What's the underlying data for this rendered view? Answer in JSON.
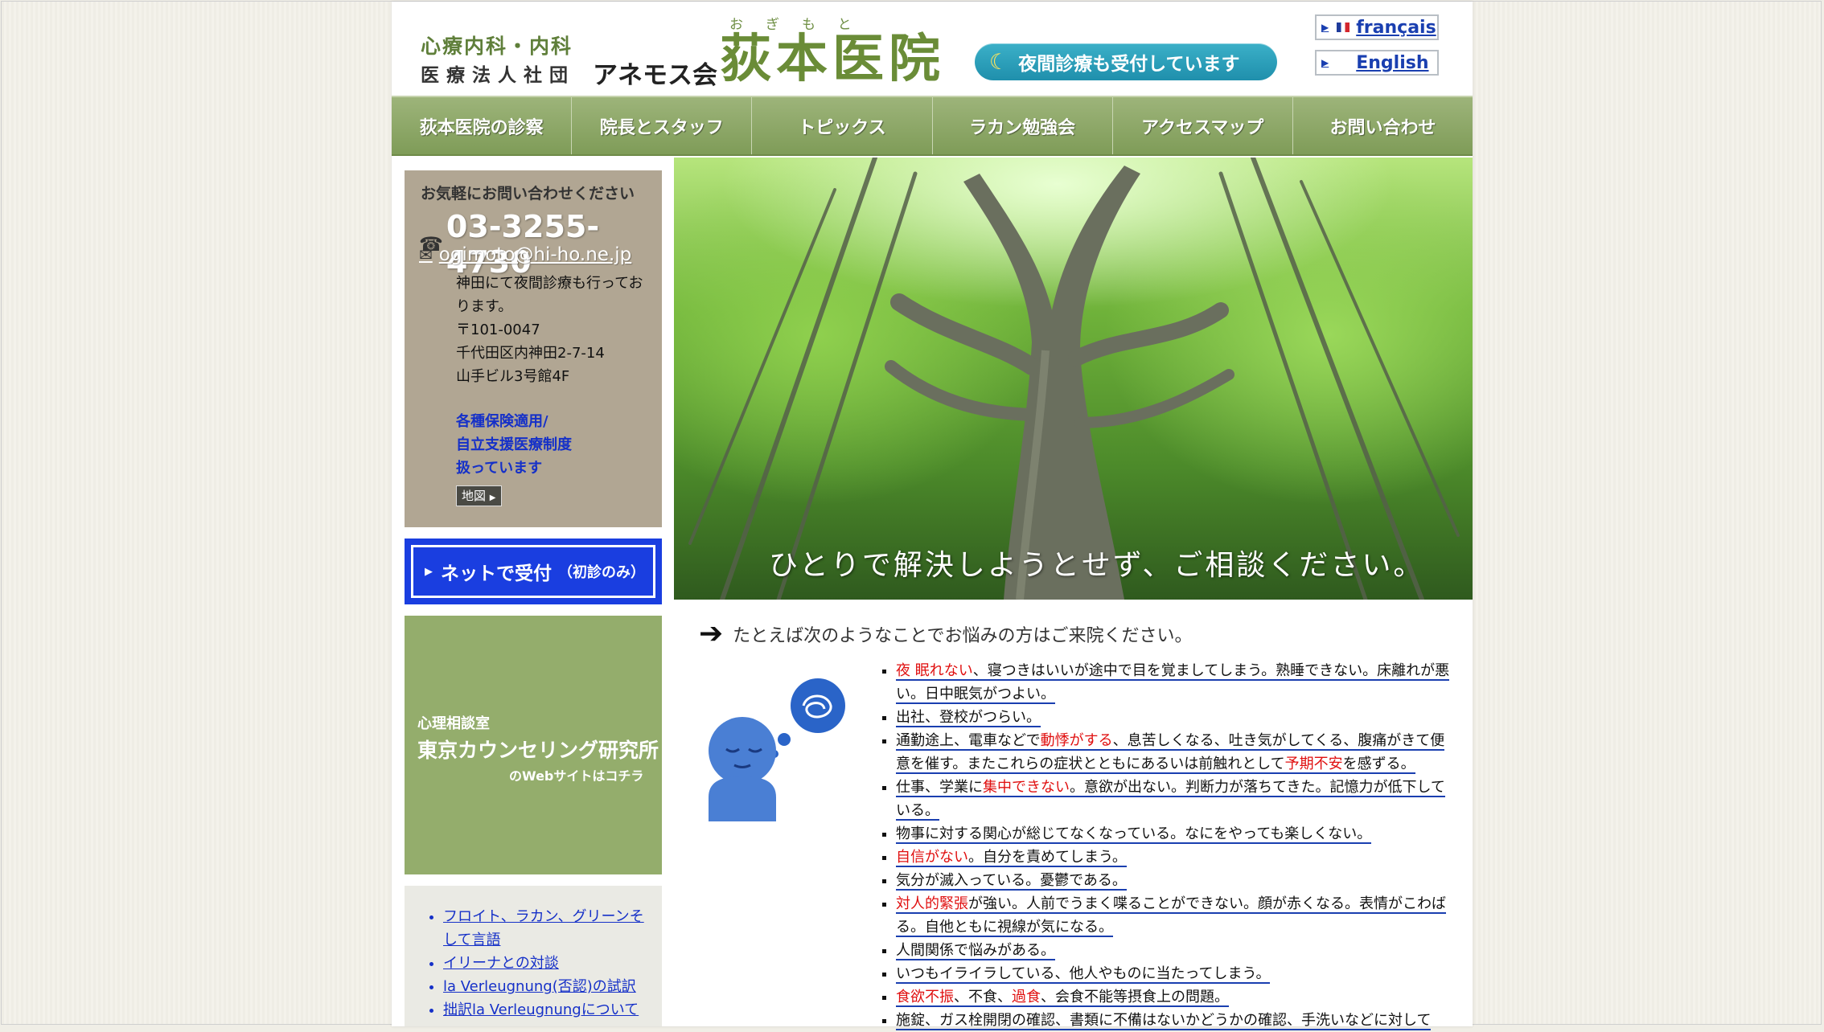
{
  "header": {
    "dept": "心療内科・内科",
    "corp": "医療法人社団",
    "assoc": "アネモス会",
    "ruby": "おぎもと",
    "hospital": "荻本医院",
    "night": "夜間診療も受付しています",
    "lang_fr": "français",
    "lang_en": "English"
  },
  "nav": [
    "荻本医院の診察",
    "院長とスタッフ",
    "トピックス",
    "ラカン勉強会",
    "アクセスマップ",
    "お問い合わせ"
  ],
  "contact": {
    "heading": "お気軽にお問い合わせください",
    "tel": "03-3255-4730",
    "email": "ogimoto@hi-ho.ne.jp",
    "addr1": "神田にて夜間診療も行っております。",
    "addr2": "〒101-0047",
    "addr3": "千代田区内神田2-7-14",
    "addr4": "山手ビル3号館4F",
    "ins1": "各種保険適用/",
    "ins2": "自立支援医療制度",
    "ins3": "扱っています",
    "map": "地図"
  },
  "net_button": {
    "label": "ネットで受付",
    "note": "（初診のみ）"
  },
  "counsel": {
    "line1": "心理相談室",
    "line2": "東京カウンセリング研究所",
    "line3": "のWebサイトはコチラ"
  },
  "links": [
    "フロイト、ラカン、グリーンそして言語",
    "イリーナとの対談",
    "la Verleugnung(否認)の試訳",
    "拙訳la Verleugnungについて"
  ],
  "hero_caption": "ひとりで解決しようとせず、ご相談ください。",
  "intro": "たとえば次のようなことでお悩みの方はご来院ください。",
  "symptoms": [
    [
      {
        "t": "夜 眠れない",
        "red": true
      },
      {
        "t": "、寝つきはいいが途中で目を覚ましてしまう。熟睡できない。床離れが悪い。日中眠気がつよい。"
      }
    ],
    [
      {
        "t": "出社、登校がつらい。"
      }
    ],
    [
      {
        "t": "通勤途上、電車などで"
      },
      {
        "t": "動悸がする",
        "red": true
      },
      {
        "t": "、息苦しくなる、吐き気がしてくる、腹痛がきて便意を催す。またこれらの症状とともにあるいは前触れとして"
      },
      {
        "t": "予期不安",
        "red": true
      },
      {
        "t": "を感ずる。"
      }
    ],
    [
      {
        "t": "仕事、学業に"
      },
      {
        "t": "集中できない",
        "red": true
      },
      {
        "t": "。意欲が出ない。判断力が落ちてきた。記憶力が低下している。"
      }
    ],
    [
      {
        "t": "物事に対する関心が総じてなくなっている。なにをやっても楽しくない。"
      }
    ],
    [
      {
        "t": "自信がない",
        "red": true
      },
      {
        "t": "。自分を責めてしまう。"
      }
    ],
    [
      {
        "t": "気分が滅入っている。憂鬱である。"
      }
    ],
    [
      {
        "t": "対人的緊張",
        "red": true
      },
      {
        "t": "が強い。人前でうまく喋ることができない。顔が赤くなる。表情がこわばる。自他ともに視線が気になる。"
      }
    ],
    [
      {
        "t": "人間関係で悩みがある。"
      }
    ],
    [
      {
        "t": "いつもイライラしている、他人やものに当たってしまう。"
      }
    ],
    [
      {
        "t": "食欲不振",
        "red": true
      },
      {
        "t": "、不食、"
      },
      {
        "t": "過食",
        "red": true
      },
      {
        "t": "、会食不能等摂食上の問題。"
      }
    ],
    [
      {
        "t": "施錠、ガス栓開閉の確認、書類に不備はないかどうかの確認、手洗いなどに対して"
      }
    ]
  ],
  "colors": {
    "accent_green": "#6a8c37",
    "nav_green": "#8aa665",
    "net_blue": "#1a3ee0",
    "link_blue": "#1530c8",
    "emphasis_red": "#e01010"
  }
}
